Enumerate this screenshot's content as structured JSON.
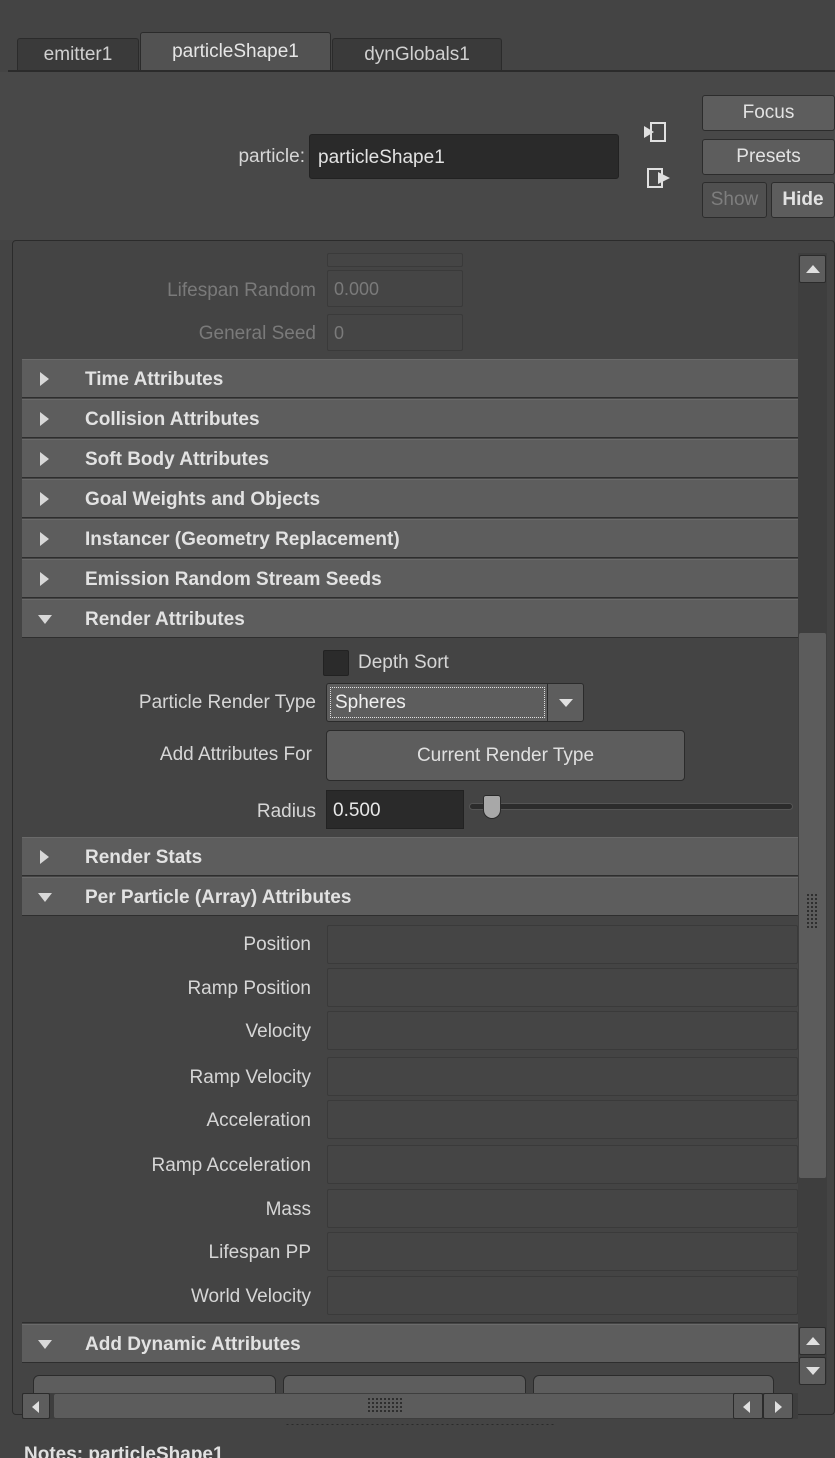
{
  "tabs": [
    {
      "label": "emitter1"
    },
    {
      "label": "particleShape1",
      "active": true
    },
    {
      "label": "dynGlobals1"
    }
  ],
  "header": {
    "label": "particle:",
    "name_value": "particleShape1",
    "focus_label": "Focus",
    "presets_label": "Presets",
    "show_label": "Show",
    "hide_label": "Hide"
  },
  "top_fields": {
    "lifespan_random_label": "Lifespan Random",
    "lifespan_random_value": "0.000",
    "general_seed_label": "General Seed",
    "general_seed_value": "0"
  },
  "sections": {
    "time": "Time Attributes",
    "collision": "Collision Attributes",
    "soft_body": "Soft Body Attributes",
    "goal": "Goal Weights and Objects",
    "instancer": "Instancer (Geometry Replacement)",
    "emission_seeds": "Emission Random Stream Seeds",
    "render": "Render Attributes",
    "render_stats": "Render Stats",
    "per_particle": "Per Particle (Array) Attributes",
    "add_dynamic": "Add Dynamic Attributes"
  },
  "render": {
    "depth_sort_label": "Depth Sort",
    "depth_sort_checked": false,
    "render_type_label": "Particle Render Type",
    "render_type_value": "Spheres",
    "add_attrs_label": "Add Attributes For",
    "add_attrs_button": "Current Render Type",
    "radius_label": "Radius",
    "radius_value": "0.500"
  },
  "per_particle": {
    "labels": [
      "Position",
      "Ramp Position",
      "Velocity",
      "Ramp Velocity",
      "Acceleration",
      "Ramp Acceleration",
      "Mass",
      "Lifespan PP",
      "World Velocity"
    ]
  },
  "notes": {
    "label": "Notes:  particleShape1"
  },
  "colors": {
    "background": "#444444",
    "section_header": "#5d5d5d",
    "field_dark": "#2a2a2a",
    "text": "#dadada"
  }
}
